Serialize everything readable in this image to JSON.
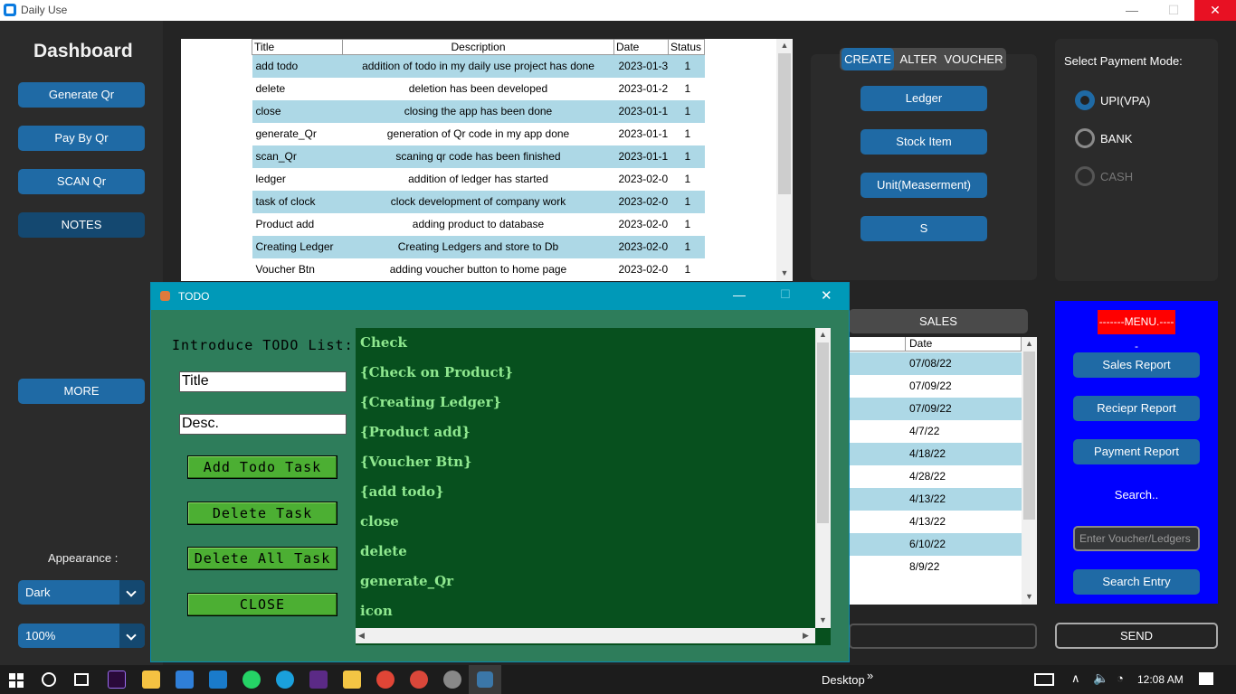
{
  "window": {
    "title": "Daily Use",
    "minimize": "—",
    "maximize": "☐",
    "close": "✕"
  },
  "sidebar": {
    "heading": "Dashboard",
    "buttons": [
      "Generate Qr",
      "Pay By Qr",
      "SCAN Qr",
      "NOTES",
      "MORE"
    ],
    "appearance_label": "Appearance :",
    "appearance_value": "Dark",
    "scaling_value": "100%"
  },
  "todo_table": {
    "columns": [
      "Title",
      "Description",
      "Date",
      "Status"
    ],
    "rows": [
      [
        "add todo",
        "addition of todo in my daily use project has done",
        "2023-01-3",
        "1"
      ],
      [
        "delete",
        "deletion has been developed",
        "2023-01-2",
        "1"
      ],
      [
        "close",
        "closing the app has been done",
        "2023-01-1",
        "1"
      ],
      [
        "generate_Qr",
        "generation of Qr code in my app done",
        "2023-01-1",
        "1"
      ],
      [
        "scan_Qr",
        "scaning qr code has been finished",
        "2023-01-1",
        "1"
      ],
      [
        "ledger",
        "addition of ledger has started",
        "2023-02-0",
        "1"
      ],
      [
        "task of clock",
        "clock development of company work",
        "2023-02-0",
        "1"
      ],
      [
        "Product add",
        "adding product to database",
        "2023-02-0",
        "1"
      ],
      [
        "Creating Ledger",
        "Creating Ledgers and store to Db",
        "2023-02-0",
        "1"
      ],
      [
        "Voucher Btn",
        "adding voucher button to home page",
        "2023-02-0",
        "1"
      ]
    ]
  },
  "create_panel": {
    "tabs": [
      "CREATE",
      "ALTER",
      "VOUCHER"
    ],
    "active_tab": "CREATE",
    "buttons": [
      "Ledger",
      "Stock Item",
      "Unit(Measerment)",
      "S"
    ]
  },
  "payment": {
    "label": "Select Payment Mode:",
    "options": [
      "UPI(VPA)",
      "BANK",
      "CASH"
    ],
    "selected": "UPI(VPA)"
  },
  "sales": {
    "tab": "SALES",
    "date_header": "Date",
    "dates": [
      "07/08/22",
      "07/09/22",
      "07/09/22",
      "4/7/22",
      "4/18/22",
      "4/28/22",
      "4/13/22",
      "4/13/22",
      "6/10/22",
      "8/9/22"
    ]
  },
  "menu": {
    "title": "-------MENU.-----",
    "buttons": [
      "Sales Report",
      "Reciepr Report",
      "Payment Report"
    ],
    "search_label": "Search..",
    "search_placeholder": "Enter Voucher/Ledgers",
    "search_button": "Search Entry",
    "send": "SEND"
  },
  "todo_window": {
    "title": "TODO",
    "intro": "Introduce TODO List:",
    "title_field": "Title",
    "desc_field": "Desc.",
    "buttons": [
      "Add Todo Task",
      "Delete Task",
      "Delete All Task",
      "CLOSE"
    ],
    "items": [
      "Check",
      "{Check on Product}",
      "{Creating Ledger}",
      "{Product add}",
      "{Voucher Btn}",
      "{add todo}",
      "close",
      "delete",
      "generate_Qr",
      "icon"
    ]
  },
  "taskbar": {
    "desktop": "Desktop",
    "time": "12:08 AM",
    "chevron": "»"
  },
  "colors": {
    "accent": "#1f6aa5",
    "menu_bg": "#0000ff",
    "todo_bg": "#2e7d5b",
    "list_bg": "#07501e",
    "row_alt": "#add8e6"
  }
}
